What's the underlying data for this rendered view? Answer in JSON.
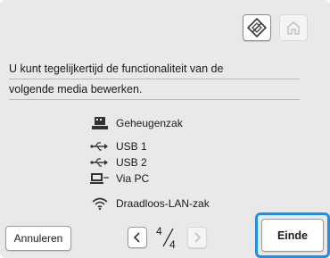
{
  "header": {
    "active_icon": "pattern-edit-icon",
    "disabled_icon": "home-icon"
  },
  "message": {
    "line1": "U kunt tegelijkertijd de functionaliteit van de",
    "line2": "volgende media bewerken."
  },
  "media": [
    {
      "icon": "memory-pocket-icon",
      "label": "Geheugenzak"
    },
    {
      "icon": "usb1-icon",
      "label": "USB 1"
    },
    {
      "icon": "usb2-icon",
      "label": "USB 2"
    },
    {
      "icon": "pc-icon",
      "label": "Via PC"
    },
    {
      "icon": "wlan-icon",
      "label": "Draadloos-LAN-zak"
    }
  ],
  "footer": {
    "cancel_label": "Annuleren",
    "page_current": "4",
    "page_total": "4",
    "end_label": "Einde"
  },
  "colors": {
    "background": "#e9e9e9",
    "focus_ring": "#1e90e6"
  }
}
